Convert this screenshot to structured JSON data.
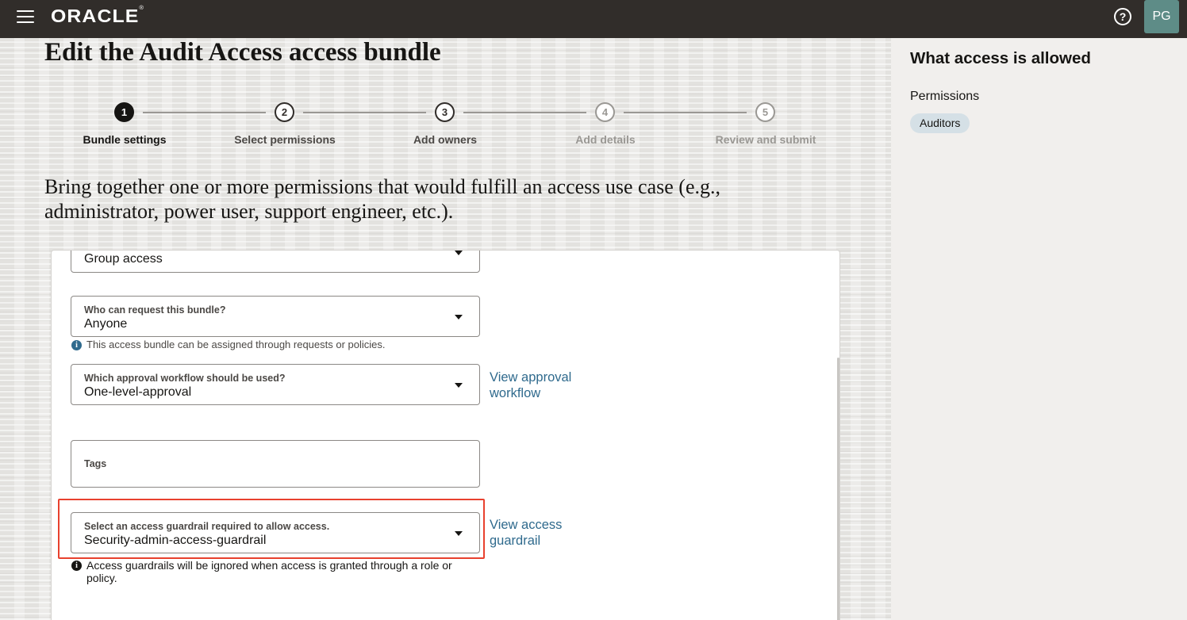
{
  "header": {
    "logo_text": "ORACLE",
    "logo_mark": "®",
    "menu_icon": "hamburger-icon",
    "help_icon": "question-circle-icon",
    "help_glyph": "?",
    "avatar_initials": "PG"
  },
  "page": {
    "title_prefix": "Edit the",
    "title_name": "Audit Access",
    "title_suffix": "access bundle",
    "intro": "Bring together one or more permissions that would fulfill an access use case (e.g., administrator, power user, support engineer, etc.)."
  },
  "steps": [
    {
      "number": "1",
      "label": "Bundle settings",
      "state": "active"
    },
    {
      "number": "2",
      "label": "Select permissions",
      "state": "upcoming"
    },
    {
      "number": "3",
      "label": "Add owners",
      "state": "upcoming"
    },
    {
      "number": "4",
      "label": "Add details",
      "state": "disabled"
    },
    {
      "number": "5",
      "label": "Review and submit",
      "state": "disabled"
    }
  ],
  "form": {
    "access_type": {
      "value": "Group access"
    },
    "requesters": {
      "label": "Who can request this bundle?",
      "value": "Anyone",
      "hint": "This access bundle can be assigned through requests or policies."
    },
    "workflow": {
      "label": "Which approval workflow should be used?",
      "value": "One-level-approval",
      "link": "View approval workflow"
    },
    "tags": {
      "label": "Tags"
    },
    "guardrail": {
      "label": "Select an access guardrail required to allow access.",
      "value": "Security-admin-access-guardrail",
      "link": "View access guardrail",
      "hint": "Access guardrails will be ignored when access is granted through a role or policy."
    }
  },
  "sidebar": {
    "title": "What access is allowed",
    "permissions_label": "Permissions",
    "permissions": [
      "Auditors"
    ]
  },
  "colors": {
    "header_bg": "#312d2a",
    "link": "#2f6a8d",
    "highlight": "#e8412e",
    "info_blue": "#2f6a8d",
    "chip_bg": "#d5e0e6"
  }
}
